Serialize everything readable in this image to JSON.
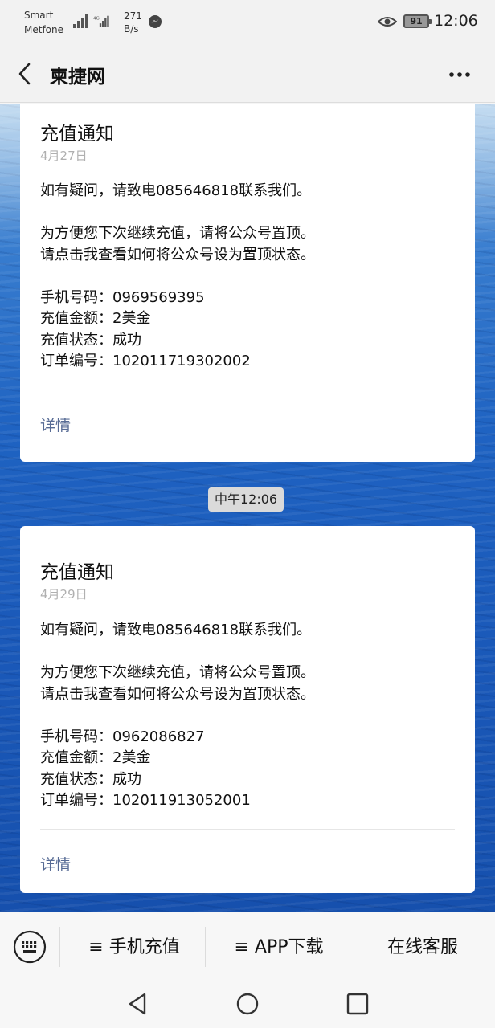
{
  "status_bar": {
    "carrier_line1": "Smart",
    "carrier_line2": "Metfone",
    "network_type": "4G",
    "speed_value": "271",
    "speed_unit": "B/s",
    "battery": "91",
    "time": "12:06",
    "icons": [
      "signal-icon",
      "signal-4g-icon",
      "messenger-icon",
      "eye-icon",
      "battery-icon"
    ]
  },
  "header": {
    "title": "柬捷网",
    "back_icon": "back-arrow-icon",
    "more_icon": "more-dots-icon"
  },
  "messages": [
    {
      "title": "充值通知",
      "date": "4月27日",
      "lines": [
        "如有疑问，请致电085646818联系我们。",
        "为方便您下次继续充值，请将公众号置顶。",
        "请点击我查看如何将公众号设为置顶状态。",
        "手机号码：0969569395",
        "充值金额：2美金",
        "充值状态：成功",
        "订单编号：102011719302002"
      ],
      "detail_label": "详情"
    },
    {
      "title": "充值通知",
      "date": "4月29日",
      "lines": [
        "如有疑问，请致电085646818联系我们。",
        "为方便您下次继续充值，请将公众号置顶。",
        "请点击我查看如何将公众号设为置顶状态。",
        "手机号码：0962086827",
        "充值金额：2美金",
        "充值状态：成功",
        "订单编号：102011913052001"
      ],
      "detail_label": "详情"
    }
  ],
  "time_divider": "中午12:06",
  "bottom_menu": {
    "keyboard_icon": "keyboard-icon",
    "items": [
      {
        "label": "≡ 手机充值"
      },
      {
        "label": "≡ APP下载"
      },
      {
        "label": "在线客服"
      }
    ]
  },
  "nav_bar": {
    "icons": [
      "nav-back-icon",
      "nav-home-icon",
      "nav-recents-icon"
    ]
  },
  "colors": {
    "link": "#576b95",
    "date": "#b0b0b0",
    "sea": "#1f63c2"
  }
}
